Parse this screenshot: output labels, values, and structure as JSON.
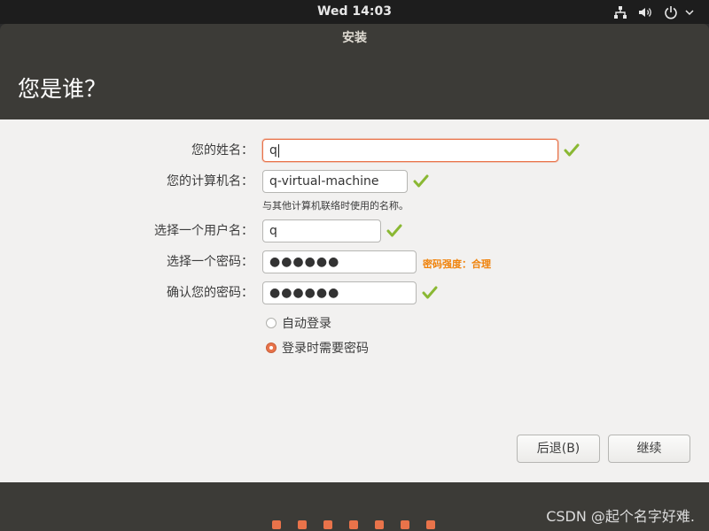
{
  "topbar": {
    "clock": "Wed 14:03",
    "icons": [
      "network-icon",
      "volume-icon",
      "power-icon",
      "chevron-down-icon"
    ]
  },
  "window": {
    "title": "安装",
    "heading": "您是谁？"
  },
  "form": {
    "name_label": "您的姓名：",
    "name_value": "q",
    "computer_label": "您的计算机名：",
    "computer_value": "q-virtual-machine",
    "computer_hint": "与其他计算机联络时使用的名称。",
    "username_label": "选择一个用户名：",
    "username_value": "q",
    "password_label": "选择一个密码：",
    "password_value": "●●●●●●",
    "password_strength": "密码强度：合理",
    "confirm_label": "确认您的密码：",
    "confirm_value": "●●●●●●",
    "login_options": [
      {
        "label": "自动登录",
        "selected": false
      },
      {
        "label": "登录时需要密码",
        "selected": true
      }
    ]
  },
  "buttons": {
    "back": "后退(B)",
    "continue": "继续"
  },
  "progress": {
    "steps_shown": 7
  },
  "watermark": "CSDN @起个名字好难.",
  "colors": {
    "accent": "#e9734a",
    "check": "#8ab833",
    "strength": "#f0820a",
    "title_bg": "#3c3b37",
    "content_bg": "#f2f1f0"
  }
}
